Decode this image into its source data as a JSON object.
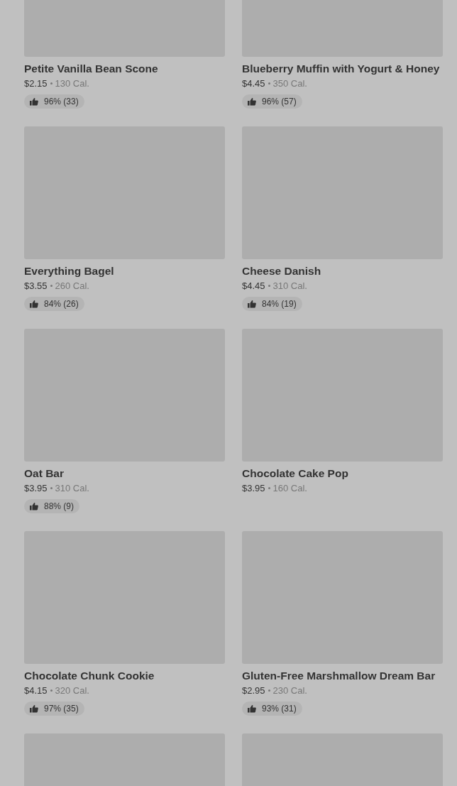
{
  "items": [
    {
      "kind": "item",
      "name": "Petite Vanilla Bean Scone",
      "price": "$2.15",
      "calories": "130 Cal.",
      "rating": "96% (33)"
    },
    {
      "kind": "item",
      "name": "Blueberry Muffin with Yogurt & Honey",
      "price": "$4.45",
      "calories": "350 Cal.",
      "rating": "96% (57)"
    },
    {
      "kind": "item",
      "name": "Everything Bagel",
      "price": "$3.55",
      "calories": "260 Cal.",
      "rating": "84% (26)"
    },
    {
      "kind": "item",
      "name": "Cheese Danish",
      "price": "$4.45",
      "calories": "310 Cal.",
      "rating": "84% (19)"
    },
    {
      "kind": "item",
      "name": "Oat Bar",
      "price": "$3.95",
      "calories": "310 Cal.",
      "rating": "88% (9)"
    },
    {
      "kind": "item",
      "name": "Chocolate Cake Pop",
      "price": "$3.95",
      "calories": "160 Cal."
    },
    {
      "kind": "item",
      "name": "Chocolate Chunk Cookie",
      "price": "$4.15",
      "calories": "320 Cal.",
      "rating": "97% (35)"
    },
    {
      "kind": "item",
      "name": "Gluten-Free Marshmallow Dream Bar",
      "price": "$2.95",
      "calories": "230 Cal.",
      "rating": "93% (31)"
    },
    {
      "kind": "image_only"
    },
    {
      "kind": "image_only"
    }
  ]
}
